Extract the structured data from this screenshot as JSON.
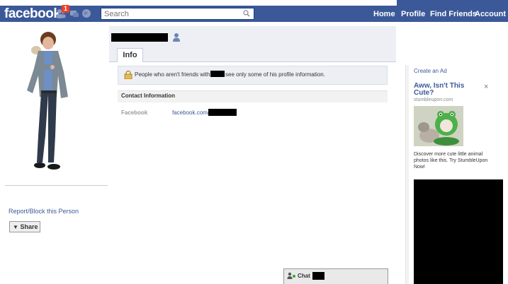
{
  "header": {
    "logo": "facebook",
    "notification_count": "1",
    "search_placeholder": "Search",
    "nav": {
      "home": "Home",
      "profile": "Profile",
      "find_friends": "Find Friends",
      "account": "Account ▾"
    }
  },
  "profile": {
    "tabs": [
      "Info"
    ]
  },
  "left": {
    "report_link": "Report/Block this Person",
    "share_label": "Share"
  },
  "notice": {
    "text_before": "People who aren't friends with",
    "text_after": "see only some of his profile information."
  },
  "contact": {
    "header": "Contact Information",
    "rows": [
      {
        "label": "Facebook",
        "value": "facebook.com/"
      }
    ]
  },
  "ad": {
    "create_ad": "Create an Ad",
    "title": "Aww, Isn't This Cute?",
    "close": "×",
    "source": "stumbleupon.com",
    "body": "Discover more cute little animal photos like this. Try StumbleUpon Now!"
  },
  "chat": {
    "label": "Chat"
  },
  "colors": {
    "brand_blue": "#3b5998",
    "notification_red": "#f03d25",
    "band_gray": "#edeff4"
  },
  "icons": {
    "friends": "friends-icon",
    "messages": "messages-icon",
    "notifications": "globe-icon",
    "search": "search-icon",
    "lock": "lock-icon",
    "chat": "chat-icon"
  }
}
